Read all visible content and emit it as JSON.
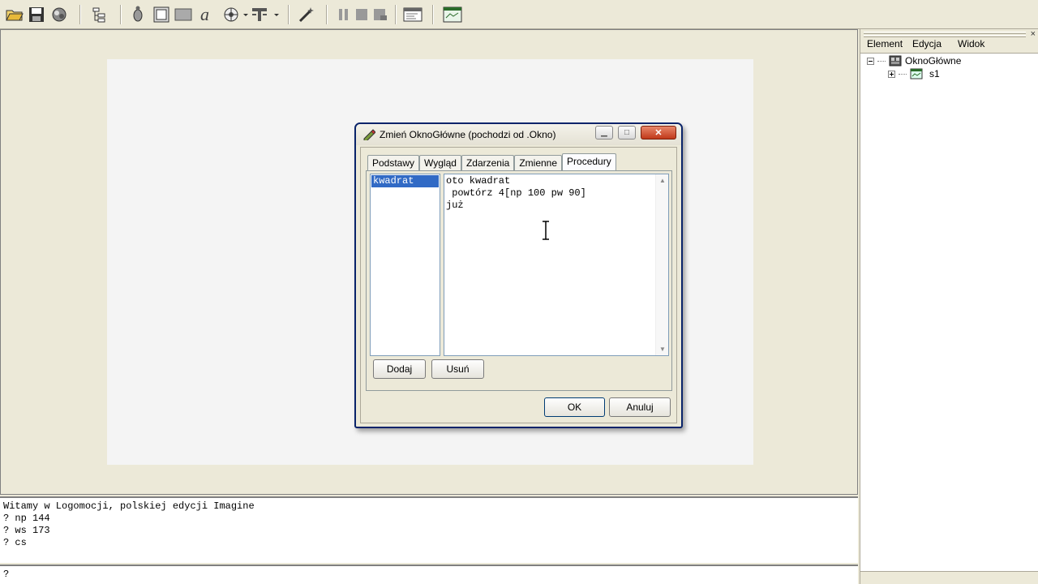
{
  "toolbar": {
    "buttons": [
      "open-folder-icon",
      "save-icon",
      "package-icon",
      "tree-structure-icon",
      "turtle-icon",
      "frame-icon",
      "panel-icon",
      "text-tool-icon",
      "control-tool-icon",
      "pin-tool-icon",
      "magic-wand-icon",
      "pause-icon",
      "stop-icon",
      "reset-icon",
      "console-icon",
      "canvas-icon"
    ]
  },
  "dialog": {
    "title": "Zmień OknoGłówne (pochodzi od .Okno)",
    "tabs": [
      "Podstawy",
      "Wygląd",
      "Zdarzenia",
      "Zmienne",
      "Procedury"
    ],
    "active_tab": "Procedury",
    "procedures": [
      "kwadrat"
    ],
    "code_lines": [
      "oto kwadrat",
      " powtórz 4[np 100 pw 90]",
      "już"
    ],
    "add_label": "Dodaj",
    "remove_label": "Usuń",
    "ok_label": "OK",
    "cancel_label": "Anuluj"
  },
  "right_panel": {
    "menu": [
      "Element",
      "Edycja",
      "Widok"
    ],
    "tree": [
      {
        "label": "OknoGłówne",
        "expander": "-"
      },
      {
        "label": "s1",
        "expander": "+"
      }
    ]
  },
  "console": {
    "lines": [
      "Witamy w Logomocji, polskiej edycji Imagine",
      "? np 144",
      "? ws 173",
      "? cs"
    ],
    "prompt": "?"
  }
}
